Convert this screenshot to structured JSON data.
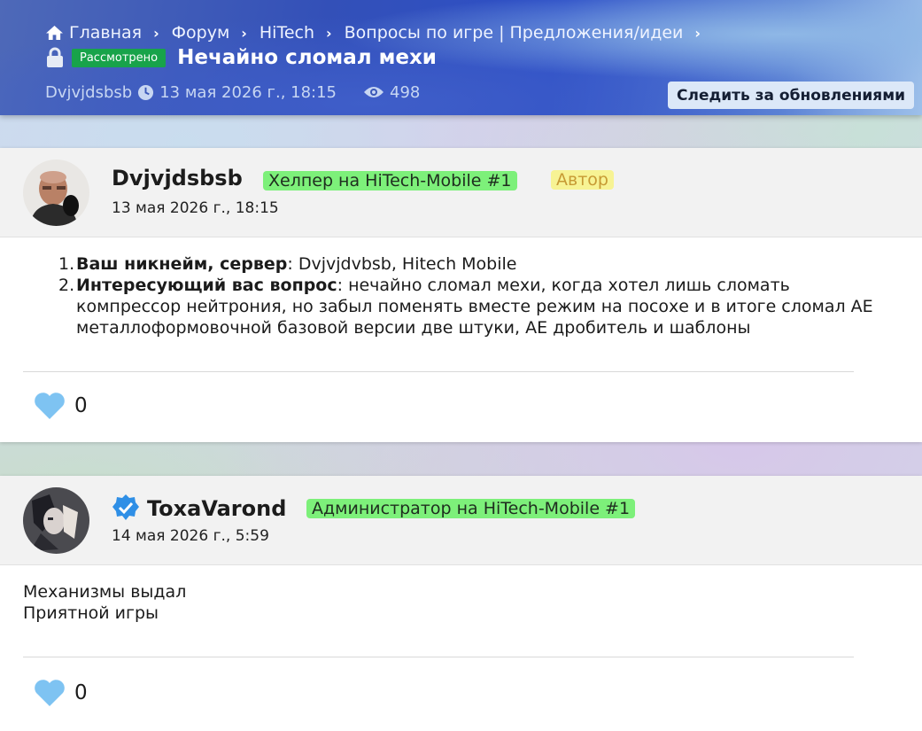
{
  "breadcrumb": [
    {
      "label": "Главная"
    },
    {
      "label": "Форум"
    },
    {
      "label": "HiTech"
    },
    {
      "label": "Вопросы по игре | Предложения/идеи"
    }
  ],
  "thread": {
    "status": "Рассмотрено",
    "title": "Нечайно сломал мехи",
    "author": "Dvjvjdsbsb",
    "date": "13 мая 2026 г., 18:15",
    "views": "498",
    "follow_label": "Следить за обновлениями"
  },
  "posts": [
    {
      "author": "Dvjvjdsbsb",
      "role": "Хелпер на HiTech-Mobile #1",
      "author_tag": "Автор",
      "date": "13 мая 2026 г., 18:15",
      "list": [
        {
          "num": "1.",
          "label": "Ваш никнейм, сервер",
          "text": ": Dvjvjdvbsb, Hitech Mobile"
        },
        {
          "num": "2.",
          "label": "Интересующий вас вопрос",
          "text": ": нечайно сломал мехи, когда хотел лишь сломать компрессор нейтрония, но забыл поменять вместе режим на посохе и в итоге сломал АЕ металлоформовочной базовой версии две штуки, АЕ дробитель и шаблоны"
        }
      ],
      "likes": "0"
    },
    {
      "author": "ToxaVarond",
      "role": "Администратор на HiTech-Mobile #1",
      "date": "14 мая 2026 г., 5:59",
      "lines": [
        "Механизмы выдал",
        "Приятной игры"
      ],
      "likes": "0"
    }
  ],
  "colors": {
    "status_badge": "#18a34a",
    "role_badge": "#7df07a",
    "author_badge": "#f7f394",
    "heart": "#7ec3f2",
    "verified": "#2f8fe6"
  }
}
